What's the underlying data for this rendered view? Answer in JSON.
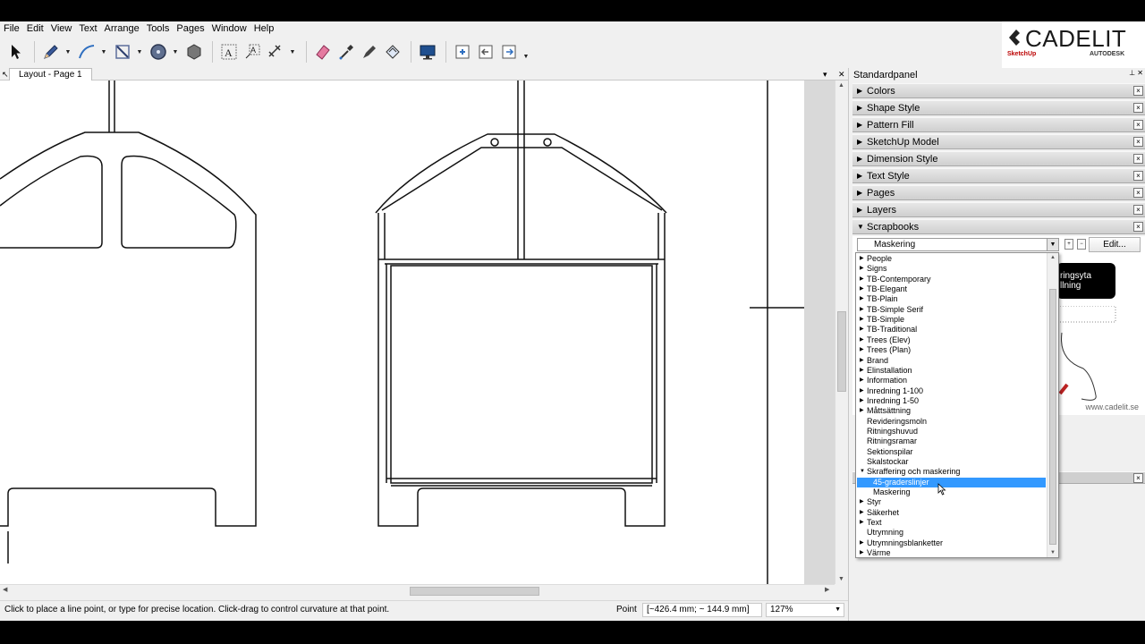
{
  "menubar": [
    "File",
    "Edit",
    "View",
    "Text",
    "Arrange",
    "Tools",
    "Pages",
    "Window",
    "Help"
  ],
  "toolbar": {
    "tools": [
      "select-tool",
      "pencil-tool",
      "line-tool",
      "rectangle-tool",
      "circle-tool",
      "polygon-tool",
      "text-tool",
      "label-tool",
      "dimension-tool",
      "eraser-tool",
      "style-tool",
      "split-tool",
      "join-tool",
      "presentation-tool",
      "add-page-tool",
      "previous-page-tool",
      "next-page-tool"
    ]
  },
  "logo": {
    "name": "CADELIT",
    "sketchup": "SketchUp",
    "autodesk": "AUTODESK"
  },
  "document": {
    "tab_label": "Layout - Page 1"
  },
  "panel": {
    "title": "Standardpanel",
    "sections": [
      "Colors",
      "Shape Style",
      "Pattern Fill",
      "SketchUp Model",
      "Dimension Style",
      "Text Style",
      "Pages",
      "Layers",
      "Scrapbooks"
    ],
    "close_glyph": "×"
  },
  "scrapbooks": {
    "selected": "Maskering",
    "edit_label": "Edit...",
    "preview_text_line1": "ringsyta",
    "preview_text_line2": "llning",
    "preview_footer": "www.cadelit.se",
    "list": [
      {
        "label": "People",
        "expandable": true,
        "child": false
      },
      {
        "label": "Signs",
        "expandable": true,
        "child": false
      },
      {
        "label": "TB-Contemporary",
        "expandable": true,
        "child": false
      },
      {
        "label": "TB-Elegant",
        "expandable": true,
        "child": false
      },
      {
        "label": "TB-Plain",
        "expandable": true,
        "child": false
      },
      {
        "label": "TB-Simple Serif",
        "expandable": true,
        "child": false
      },
      {
        "label": "TB-Simple",
        "expandable": true,
        "child": false
      },
      {
        "label": "TB-Traditional",
        "expandable": true,
        "child": false
      },
      {
        "label": "Trees (Elev)",
        "expandable": true,
        "child": false
      },
      {
        "label": "Trees (Plan)",
        "expandable": true,
        "child": false
      },
      {
        "label": "Brand",
        "expandable": true,
        "child": false
      },
      {
        "label": "Elinstallation",
        "expandable": true,
        "child": false
      },
      {
        "label": "Information",
        "expandable": true,
        "child": false
      },
      {
        "label": "Inredning 1-100",
        "expandable": true,
        "child": false
      },
      {
        "label": "Inredning 1-50",
        "expandable": true,
        "child": false
      },
      {
        "label": "Måttsättning",
        "expandable": true,
        "child": false
      },
      {
        "label": "Revideringsmoln",
        "expandable": false,
        "child": false
      },
      {
        "label": "Ritningshuvud",
        "expandable": false,
        "child": false
      },
      {
        "label": "Ritningsramar",
        "expandable": false,
        "child": false
      },
      {
        "label": "Sektionspilar",
        "expandable": false,
        "child": false
      },
      {
        "label": "Skalstockar",
        "expandable": false,
        "child": false
      },
      {
        "label": "Skraffering och maskering",
        "expandable": true,
        "expanded": true,
        "child": false
      },
      {
        "label": "45-graderslinjer",
        "expandable": false,
        "child": true,
        "selected": true
      },
      {
        "label": "Maskering",
        "expandable": false,
        "child": true
      },
      {
        "label": "Styr",
        "expandable": true,
        "child": false
      },
      {
        "label": "Säkerhet",
        "expandable": true,
        "child": false
      },
      {
        "label": "Text",
        "expandable": true,
        "child": false
      },
      {
        "label": "Utrymning",
        "expandable": false,
        "child": false
      },
      {
        "label": "Utrymningsblanketter",
        "expandable": true,
        "child": false
      },
      {
        "label": "Värme",
        "expandable": true,
        "child": false
      }
    ]
  },
  "status": {
    "hint": "Click to place a line point, or type for precise location. Click-drag to control curvature at that point.",
    "mode": "Point",
    "coords": "[~426.4 mm; ~ 144.9 mm]",
    "zoom": "127%"
  },
  "colors": {
    "selection": "#3399ff",
    "panel_bg": "#f0f0f0",
    "canvas_bg": "#ffffff"
  }
}
